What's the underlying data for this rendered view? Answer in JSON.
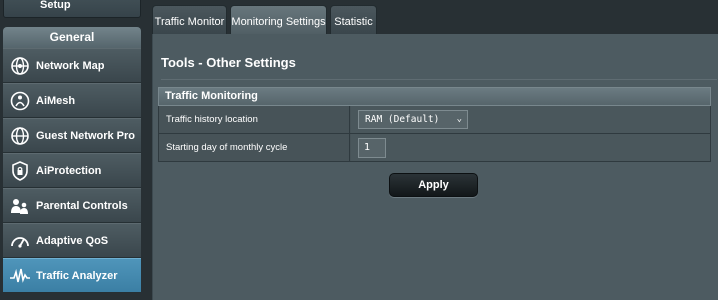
{
  "sidebar": {
    "top_item": "Setup",
    "section_title": "General",
    "items": [
      {
        "label": "Network Map",
        "icon": "network-map-icon"
      },
      {
        "label": "AiMesh",
        "icon": "aimesh-icon"
      },
      {
        "label": "Guest Network Pro",
        "icon": "guest-network-icon"
      },
      {
        "label": "AiProtection",
        "icon": "aiprotection-icon"
      },
      {
        "label": "Parental Controls",
        "icon": "parental-controls-icon"
      },
      {
        "label": "Adaptive QoS",
        "icon": "adaptive-qos-icon"
      },
      {
        "label": "Traffic Analyzer",
        "icon": "traffic-analyzer-icon",
        "active": true
      }
    ]
  },
  "tabs": [
    {
      "label": "Traffic Monitor"
    },
    {
      "label": "Monitoring Settings",
      "active": true
    },
    {
      "label": "Statistic"
    }
  ],
  "main": {
    "page_title": "Tools - Other Settings",
    "section_header": "Traffic Monitoring",
    "rows": [
      {
        "label": "Traffic history location",
        "value": "RAM (Default)"
      },
      {
        "label": "Starting day of monthly cycle",
        "value": "1"
      }
    ],
    "apply_label": "Apply"
  },
  "colors": {
    "active_blue": "#3f86ac",
    "panel_gray": "#4d5b61",
    "background": "#283034"
  }
}
